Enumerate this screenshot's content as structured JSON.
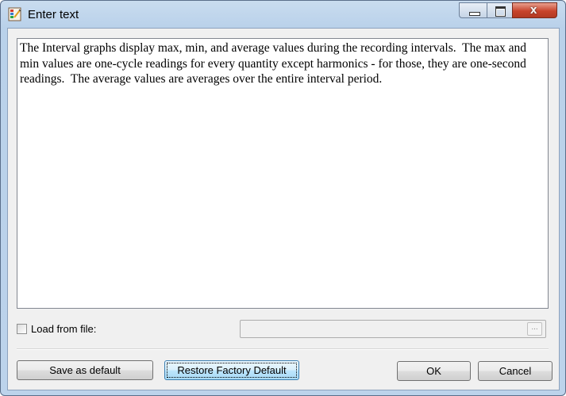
{
  "window": {
    "title": "Enter text",
    "icon": "app-icon"
  },
  "caption_buttons": {
    "minimize": "minimize-icon",
    "maximize": "maximize-icon",
    "close": "close-icon",
    "close_glyph": "x"
  },
  "editor": {
    "text": "The Interval graphs display max, min, and average values during the recording intervals.  The max and min values are one-cycle readings for every quantity except harmonics - for those, they are one-second readings.  The average values are averages over the entire interval period."
  },
  "load_from_file": {
    "label": "Load from file:",
    "checked": false,
    "path_value": "",
    "browse_label": "..."
  },
  "buttons": {
    "save_default": "Save as default",
    "restore_factory": "Restore Factory Default",
    "ok": "OK",
    "cancel": "Cancel"
  }
}
